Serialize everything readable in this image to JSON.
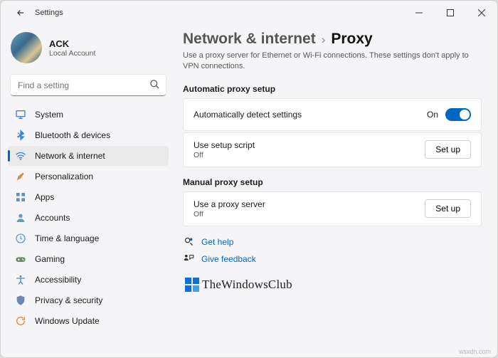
{
  "window": {
    "title": "Settings"
  },
  "profile": {
    "name": "ACK",
    "account_type": "Local Account"
  },
  "search": {
    "placeholder": "Find a setting"
  },
  "sidebar": {
    "items": [
      {
        "label": "System",
        "icon": "system-icon",
        "selected": false
      },
      {
        "label": "Bluetooth & devices",
        "icon": "bluetooth-icon",
        "selected": false
      },
      {
        "label": "Network & internet",
        "icon": "wifi-icon",
        "selected": true
      },
      {
        "label": "Personalization",
        "icon": "personalization-icon",
        "selected": false
      },
      {
        "label": "Apps",
        "icon": "apps-icon",
        "selected": false
      },
      {
        "label": "Accounts",
        "icon": "accounts-icon",
        "selected": false
      },
      {
        "label": "Time & language",
        "icon": "time-language-icon",
        "selected": false
      },
      {
        "label": "Gaming",
        "icon": "gaming-icon",
        "selected": false
      },
      {
        "label": "Accessibility",
        "icon": "accessibility-icon",
        "selected": false
      },
      {
        "label": "Privacy & security",
        "icon": "privacy-icon",
        "selected": false
      },
      {
        "label": "Windows Update",
        "icon": "update-icon",
        "selected": false
      }
    ]
  },
  "breadcrumb": {
    "parent": "Network & internet",
    "separator": "›",
    "current": "Proxy"
  },
  "description": "Use a proxy server for Ethernet or Wi-Fi connections. These settings don't apply to VPN connections.",
  "sections": {
    "auto": {
      "title": "Automatic proxy setup",
      "detect": {
        "label": "Automatically detect settings",
        "state_label": "On",
        "state": true
      },
      "script": {
        "label": "Use setup script",
        "status": "Off",
        "button": "Set up"
      }
    },
    "manual": {
      "title": "Manual proxy setup",
      "server": {
        "label": "Use a proxy server",
        "status": "Off",
        "button": "Set up"
      }
    }
  },
  "links": {
    "help": "Get help",
    "feedback": "Give feedback"
  },
  "watermark": {
    "text": "TheWindowsClub"
  },
  "source_attrib": "wsxdn.com",
  "icons": {
    "system": "#3b82d8",
    "bluetooth": "#3b82d8",
    "wifi": "#3b82d8",
    "personalization": "#d98b4a",
    "apps": "#6b90b8",
    "accounts": "#5aa0c0",
    "time": "#5aa0c0",
    "gaming": "#6a8a6a",
    "accessibility": "#4a88c0",
    "privacy": "#6a88b0",
    "update": "#d88a3a"
  }
}
